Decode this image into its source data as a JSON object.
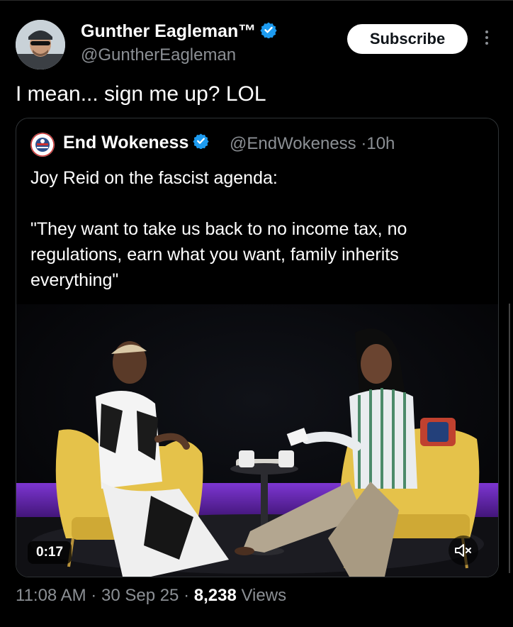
{
  "author": {
    "name": "Gunther Eagleman™",
    "handle": "@GuntherEagleman",
    "verified": true
  },
  "actions": {
    "subscribe_label": "Subscribe",
    "more_icon": "more-vertical-icon"
  },
  "tweet": {
    "text": "I mean... sign me up? LOL"
  },
  "quoted": {
    "name": "End Wokeness",
    "handle": "@EndWokeness",
    "separator": "·",
    "age": "10h",
    "text": "Joy Reid on the fascist agenda:\n\n\"They want to take us back to no income tax, no regulations, earn what you want, family inherits everything\"",
    "video": {
      "duration": "0:17",
      "mute_icon": "speaker-muted-icon"
    }
  },
  "meta": {
    "time": "11:08 AM",
    "date": "30 Sep 25",
    "views_count": "8,238",
    "views_label": "Views",
    "separator": "·"
  },
  "colors": {
    "background": "#000000",
    "verified": "#1d9bf0",
    "muted_text": "#8b8f94",
    "chair": "#e5c24a",
    "stage_glow": "#7b2fd6"
  }
}
